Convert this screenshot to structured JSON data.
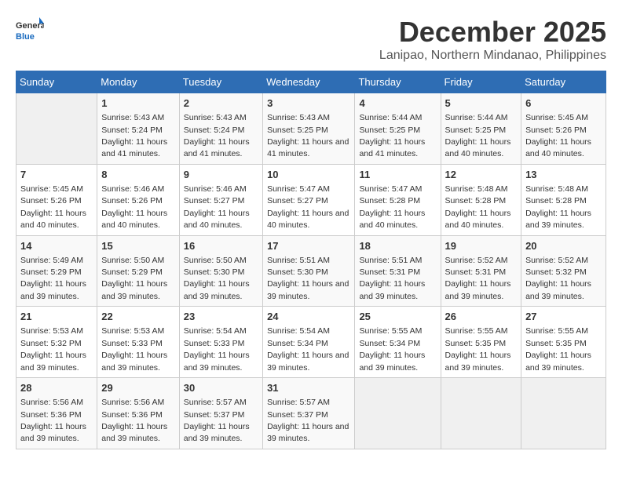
{
  "logo": {
    "line1": "General",
    "line2": "Blue"
  },
  "header": {
    "month": "December 2025",
    "location": "Lanipao, Northern Mindanao, Philippines"
  },
  "weekdays": [
    "Sunday",
    "Monday",
    "Tuesday",
    "Wednesday",
    "Thursday",
    "Friday",
    "Saturday"
  ],
  "weeks": [
    [
      {
        "day": "",
        "empty": true
      },
      {
        "day": "1",
        "sunrise": "5:43 AM",
        "sunset": "5:24 PM",
        "daylight": "11 hours and 41 minutes."
      },
      {
        "day": "2",
        "sunrise": "5:43 AM",
        "sunset": "5:24 PM",
        "daylight": "11 hours and 41 minutes."
      },
      {
        "day": "3",
        "sunrise": "5:43 AM",
        "sunset": "5:25 PM",
        "daylight": "11 hours and 41 minutes."
      },
      {
        "day": "4",
        "sunrise": "5:44 AM",
        "sunset": "5:25 PM",
        "daylight": "11 hours and 41 minutes."
      },
      {
        "day": "5",
        "sunrise": "5:44 AM",
        "sunset": "5:25 PM",
        "daylight": "11 hours and 40 minutes."
      },
      {
        "day": "6",
        "sunrise": "5:45 AM",
        "sunset": "5:26 PM",
        "daylight": "11 hours and 40 minutes."
      }
    ],
    [
      {
        "day": "7",
        "sunrise": "5:45 AM",
        "sunset": "5:26 PM",
        "daylight": "11 hours and 40 minutes."
      },
      {
        "day": "8",
        "sunrise": "5:46 AM",
        "sunset": "5:26 PM",
        "daylight": "11 hours and 40 minutes."
      },
      {
        "day": "9",
        "sunrise": "5:46 AM",
        "sunset": "5:27 PM",
        "daylight": "11 hours and 40 minutes."
      },
      {
        "day": "10",
        "sunrise": "5:47 AM",
        "sunset": "5:27 PM",
        "daylight": "11 hours and 40 minutes."
      },
      {
        "day": "11",
        "sunrise": "5:47 AM",
        "sunset": "5:28 PM",
        "daylight": "11 hours and 40 minutes."
      },
      {
        "day": "12",
        "sunrise": "5:48 AM",
        "sunset": "5:28 PM",
        "daylight": "11 hours and 40 minutes."
      },
      {
        "day": "13",
        "sunrise": "5:48 AM",
        "sunset": "5:28 PM",
        "daylight": "11 hours and 39 minutes."
      }
    ],
    [
      {
        "day": "14",
        "sunrise": "5:49 AM",
        "sunset": "5:29 PM",
        "daylight": "11 hours and 39 minutes."
      },
      {
        "day": "15",
        "sunrise": "5:50 AM",
        "sunset": "5:29 PM",
        "daylight": "11 hours and 39 minutes."
      },
      {
        "day": "16",
        "sunrise": "5:50 AM",
        "sunset": "5:30 PM",
        "daylight": "11 hours and 39 minutes."
      },
      {
        "day": "17",
        "sunrise": "5:51 AM",
        "sunset": "5:30 PM",
        "daylight": "11 hours and 39 minutes."
      },
      {
        "day": "18",
        "sunrise": "5:51 AM",
        "sunset": "5:31 PM",
        "daylight": "11 hours and 39 minutes."
      },
      {
        "day": "19",
        "sunrise": "5:52 AM",
        "sunset": "5:31 PM",
        "daylight": "11 hours and 39 minutes."
      },
      {
        "day": "20",
        "sunrise": "5:52 AM",
        "sunset": "5:32 PM",
        "daylight": "11 hours and 39 minutes."
      }
    ],
    [
      {
        "day": "21",
        "sunrise": "5:53 AM",
        "sunset": "5:32 PM",
        "daylight": "11 hours and 39 minutes."
      },
      {
        "day": "22",
        "sunrise": "5:53 AM",
        "sunset": "5:33 PM",
        "daylight": "11 hours and 39 minutes."
      },
      {
        "day": "23",
        "sunrise": "5:54 AM",
        "sunset": "5:33 PM",
        "daylight": "11 hours and 39 minutes."
      },
      {
        "day": "24",
        "sunrise": "5:54 AM",
        "sunset": "5:34 PM",
        "daylight": "11 hours and 39 minutes."
      },
      {
        "day": "25",
        "sunrise": "5:55 AM",
        "sunset": "5:34 PM",
        "daylight": "11 hours and 39 minutes."
      },
      {
        "day": "26",
        "sunrise": "5:55 AM",
        "sunset": "5:35 PM",
        "daylight": "11 hours and 39 minutes."
      },
      {
        "day": "27",
        "sunrise": "5:55 AM",
        "sunset": "5:35 PM",
        "daylight": "11 hours and 39 minutes."
      }
    ],
    [
      {
        "day": "28",
        "sunrise": "5:56 AM",
        "sunset": "5:36 PM",
        "daylight": "11 hours and 39 minutes."
      },
      {
        "day": "29",
        "sunrise": "5:56 AM",
        "sunset": "5:36 PM",
        "daylight": "11 hours and 39 minutes."
      },
      {
        "day": "30",
        "sunrise": "5:57 AM",
        "sunset": "5:37 PM",
        "daylight": "11 hours and 39 minutes."
      },
      {
        "day": "31",
        "sunrise": "5:57 AM",
        "sunset": "5:37 PM",
        "daylight": "11 hours and 39 minutes."
      },
      {
        "day": "",
        "empty": true
      },
      {
        "day": "",
        "empty": true
      },
      {
        "day": "",
        "empty": true
      }
    ]
  ],
  "labels": {
    "sunrise": "Sunrise:",
    "sunset": "Sunset:",
    "daylight": "Daylight:"
  }
}
